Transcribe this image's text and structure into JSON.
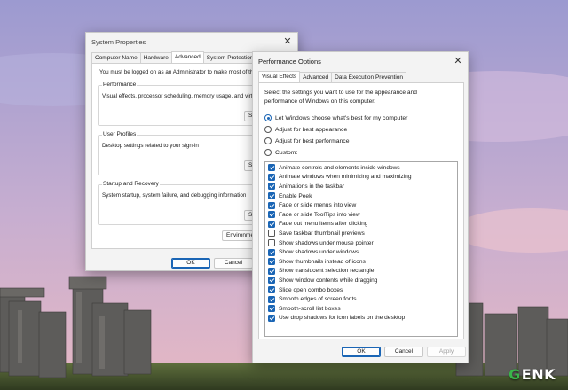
{
  "colors": {
    "accent": "#1a65b5",
    "sky_top": "#a9a3cf",
    "sky_bottom": "#ddb5c6"
  },
  "system_properties": {
    "title": "System Properties",
    "tabs": [
      "Computer Name",
      "Hardware",
      "Advanced",
      "System Protection",
      "Re"
    ],
    "active_tab": "Advanced",
    "admin_note": "You must be logged on as an Administrator to make most of the",
    "performance": {
      "legend": "Performance",
      "desc": "Visual effects, processor scheduling, memory usage, and virtual",
      "button": "Se"
    },
    "user_profiles": {
      "legend": "User Profiles",
      "desc": "Desktop settings related to your sign-in",
      "button": "Se"
    },
    "startup": {
      "legend": "Startup and Recovery",
      "desc": "System startup, system failure, and debugging information",
      "button": "Se"
    },
    "env_button": "Environment",
    "ok": "OK",
    "cancel": "Cancel"
  },
  "performance_options": {
    "title": "Performance Options",
    "tabs": [
      "Visual Effects",
      "Advanced",
      "Data Execution Prevention"
    ],
    "active_tab": "Visual Effects",
    "instructions_line1": "Select the settings you want to use for the appearance and",
    "instructions_line2": "performance of Windows on this computer.",
    "radios": [
      {
        "label": "Let Windows choose what's best for my computer",
        "selected": true
      },
      {
        "label": "Adjust for best appearance",
        "selected": false
      },
      {
        "label": "Adjust for best performance",
        "selected": false
      },
      {
        "label": "Custom:",
        "selected": false
      }
    ],
    "effects": [
      {
        "label": "Animate controls and elements inside windows",
        "checked": true
      },
      {
        "label": "Animate windows when minimizing and maximizing",
        "checked": true
      },
      {
        "label": "Animations in the taskbar",
        "checked": true
      },
      {
        "label": "Enable Peek",
        "checked": true
      },
      {
        "label": "Fade or slide menus into view",
        "checked": true
      },
      {
        "label": "Fade or slide ToolTips into view",
        "checked": true
      },
      {
        "label": "Fade out menu items after clicking",
        "checked": true
      },
      {
        "label": "Save taskbar thumbnail previews",
        "checked": false
      },
      {
        "label": "Show shadows under mouse pointer",
        "checked": false
      },
      {
        "label": "Show shadows under windows",
        "checked": true
      },
      {
        "label": "Show thumbnails instead of icons",
        "checked": true
      },
      {
        "label": "Show translucent selection rectangle",
        "checked": true
      },
      {
        "label": "Show window contents while dragging",
        "checked": true
      },
      {
        "label": "Slide open combo boxes",
        "checked": true
      },
      {
        "label": "Smooth edges of screen fonts",
        "checked": true
      },
      {
        "label": "Smooth-scroll list boxes",
        "checked": true
      },
      {
        "label": "Use drop shadows for icon labels on the desktop",
        "checked": true
      }
    ],
    "ok": "OK",
    "cancel": "Cancel",
    "apply": "Apply"
  },
  "watermark": {
    "g": "G",
    "rest": "ENK"
  }
}
